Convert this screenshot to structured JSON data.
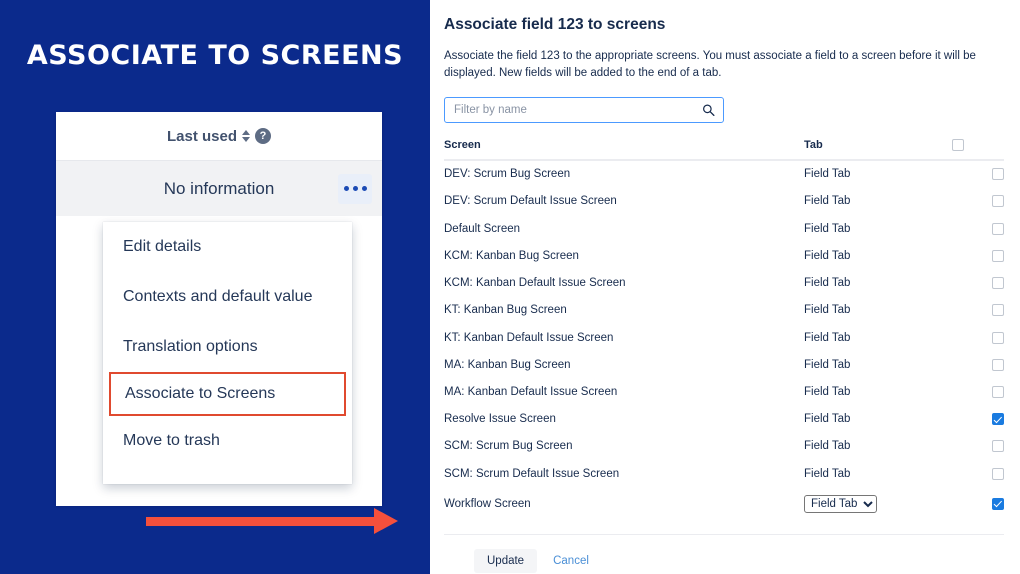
{
  "left_panel": {
    "title": "ASSOCIATE TO SCREENS",
    "background_color": "#0b2a8c",
    "card": {
      "sort_label": "Last used",
      "help_icon": "question-circle-icon",
      "sort_icon": "sort-updown-icon",
      "row_label": "No information",
      "more_icon": "ellipsis-icon"
    },
    "menu": {
      "items": [
        {
          "label": "Edit details",
          "highlighted": false
        },
        {
          "label": "Contexts and default value",
          "highlighted": false
        },
        {
          "label": "Translation options",
          "highlighted": false
        },
        {
          "label": "Associate to Screens",
          "highlighted": true
        },
        {
          "label": "Move to trash",
          "highlighted": false
        }
      ],
      "highlight_color": "#e04a2f"
    },
    "arrow": {
      "icon": "right-arrow-icon",
      "color": "#f5503c"
    }
  },
  "right_panel": {
    "title": "Associate field 123 to screens",
    "description": "Associate the field 123 to the appropriate screens. You must associate a field to a screen before it will be displayed. New fields will be added to the end of a tab.",
    "filter": {
      "placeholder": "Filter by name",
      "value": "",
      "icon": "search-icon"
    },
    "table": {
      "headers": {
        "screen": "Screen",
        "tab": "Tab",
        "select_all": ""
      },
      "select_all_checked": false,
      "rows": [
        {
          "screen": "DEV: Scrum Bug Screen",
          "tab": "Field Tab",
          "checked": false,
          "is_select": false
        },
        {
          "screen": "DEV: Scrum Default Issue Screen",
          "tab": "Field Tab",
          "checked": false,
          "is_select": false
        },
        {
          "screen": "Default Screen",
          "tab": "Field Tab",
          "checked": false,
          "is_select": false
        },
        {
          "screen": "KCM: Kanban Bug Screen",
          "tab": "Field Tab",
          "checked": false,
          "is_select": false
        },
        {
          "screen": "KCM: Kanban Default Issue Screen",
          "tab": "Field Tab",
          "checked": false,
          "is_select": false
        },
        {
          "screen": "KT: Kanban Bug Screen",
          "tab": "Field Tab",
          "checked": false,
          "is_select": false
        },
        {
          "screen": "KT: Kanban Default Issue Screen",
          "tab": "Field Tab",
          "checked": false,
          "is_select": false
        },
        {
          "screen": "MA: Kanban Bug Screen",
          "tab": "Field Tab",
          "checked": false,
          "is_select": false
        },
        {
          "screen": "MA: Kanban Default Issue Screen",
          "tab": "Field Tab",
          "checked": false,
          "is_select": false
        },
        {
          "screen": "Resolve Issue Screen",
          "tab": "Field Tab",
          "checked": true,
          "is_select": false
        },
        {
          "screen": "SCM: Scrum Bug Screen",
          "tab": "Field Tab",
          "checked": false,
          "is_select": false
        },
        {
          "screen": "SCM: Scrum Default Issue Screen",
          "tab": "Field Tab",
          "checked": false,
          "is_select": false
        },
        {
          "screen": "Workflow Screen",
          "tab": "Field Tab",
          "checked": true,
          "is_select": true
        }
      ],
      "tab_options": [
        "Field Tab"
      ]
    },
    "actions": {
      "update_label": "Update",
      "cancel_label": "Cancel",
      "checked_color": "#1a7be0",
      "cancel_color": "#4a8fd6"
    }
  }
}
